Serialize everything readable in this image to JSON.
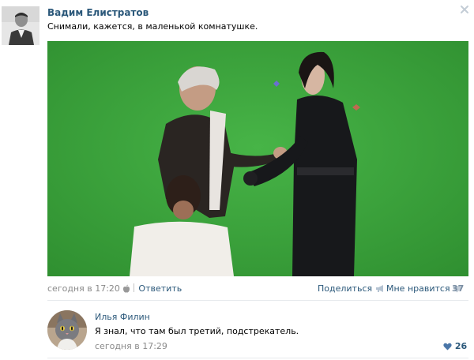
{
  "post": {
    "author": "Вадим Елистратов",
    "text": "Снимали, кажется, в маленькой комнатушке.",
    "close_icon": "close-icon",
    "photo_icon": "green-screen-film-set-photo",
    "time": "сегодня в 17:20",
    "reply_label": "Ответить",
    "share_label": "Поделиться",
    "like_label": "Мне нравится",
    "like_count": "37"
  },
  "comment": {
    "author": "Илья Филин",
    "text": "Я знал, что там был третий, подстрекатель.",
    "time": "сегодня в 17:29",
    "like_count": "26"
  },
  "colors": {
    "link": "#2b587a",
    "muted": "#8a8a8a",
    "like_grey": "#7a8ea3",
    "divider": "#e7eaed",
    "green_screen": "#3aa33a"
  }
}
